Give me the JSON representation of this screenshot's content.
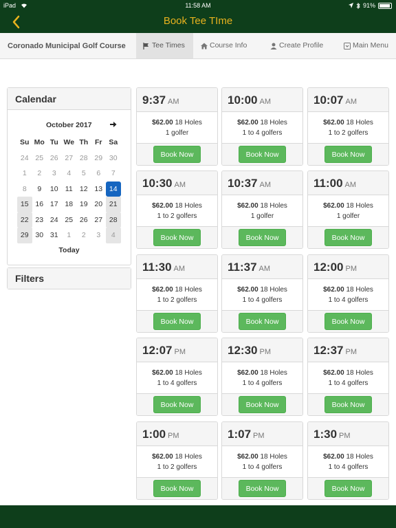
{
  "status": {
    "carrier": "iPad",
    "time": "11:58 AM",
    "battery": "91%"
  },
  "header": {
    "title": "Book Tee TIme"
  },
  "nav": {
    "brand": "Coronado Municipal Golf Course",
    "items": [
      {
        "label": "Tee Times",
        "icon": "flag-icon"
      },
      {
        "label": "Course Info",
        "icon": "home-icon"
      },
      {
        "label": "Create Profile",
        "icon": "user-icon"
      },
      {
        "label": "Main Menu",
        "icon": "menu-icon"
      }
    ]
  },
  "calendar": {
    "title": "Calendar",
    "month": "October 2017",
    "weekdays": [
      "Su",
      "Mo",
      "Tu",
      "We",
      "Th",
      "Fr",
      "Sa"
    ],
    "weeks": [
      [
        "24",
        "25",
        "26",
        "27",
        "28",
        "29",
        "30"
      ],
      [
        "1",
        "2",
        "3",
        "4",
        "5",
        "6",
        "7"
      ],
      [
        "8",
        "9",
        "10",
        "11",
        "12",
        "13",
        "14"
      ],
      [
        "15",
        "16",
        "17",
        "18",
        "19",
        "20",
        "21"
      ],
      [
        "22",
        "23",
        "24",
        "25",
        "26",
        "27",
        "28"
      ],
      [
        "29",
        "30",
        "31",
        "1",
        "2",
        "3",
        "4"
      ]
    ],
    "selected_day": "14",
    "today_label": "Today"
  },
  "filters": {
    "title": "Filters"
  },
  "tee_times": [
    {
      "time": "9:37",
      "ampm": "AM",
      "price": "$62.00",
      "holes": "18 Holes",
      "golfers": "1 golfer",
      "button": "Book Now"
    },
    {
      "time": "10:00",
      "ampm": "AM",
      "price": "$62.00",
      "holes": "18 Holes",
      "golfers": "1 to 4 golfers",
      "button": "Book Now"
    },
    {
      "time": "10:07",
      "ampm": "AM",
      "price": "$62.00",
      "holes": "18 Holes",
      "golfers": "1 to 2 golfers",
      "button": "Book Now"
    },
    {
      "time": "10:30",
      "ampm": "AM",
      "price": "$62.00",
      "holes": "18 Holes",
      "golfers": "1 to 2 golfers",
      "button": "Book Now"
    },
    {
      "time": "10:37",
      "ampm": "AM",
      "price": "$62.00",
      "holes": "18 Holes",
      "golfers": "1 golfer",
      "button": "Book Now"
    },
    {
      "time": "11:00",
      "ampm": "AM",
      "price": "$62.00",
      "holes": "18 Holes",
      "golfers": "1 golfer",
      "button": "Book Now"
    },
    {
      "time": "11:30",
      "ampm": "AM",
      "price": "$62.00",
      "holes": "18 Holes",
      "golfers": "1 to 2 golfers",
      "button": "Book Now"
    },
    {
      "time": "11:37",
      "ampm": "AM",
      "price": "$62.00",
      "holes": "18 Holes",
      "golfers": "1 to 4 golfers",
      "button": "Book Now"
    },
    {
      "time": "12:00",
      "ampm": "PM",
      "price": "$62.00",
      "holes": "18 Holes",
      "golfers": "1 to 4 golfers",
      "button": "Book Now"
    },
    {
      "time": "12:07",
      "ampm": "PM",
      "price": "$62.00",
      "holes": "18 Holes",
      "golfers": "1 to 4 golfers",
      "button": "Book Now"
    },
    {
      "time": "12:30",
      "ampm": "PM",
      "price": "$62.00",
      "holes": "18 Holes",
      "golfers": "1 to 4 golfers",
      "button": "Book Now"
    },
    {
      "time": "12:37",
      "ampm": "PM",
      "price": "$62.00",
      "holes": "18 Holes",
      "golfers": "1 to 4 golfers",
      "button": "Book Now"
    },
    {
      "time": "1:00",
      "ampm": "PM",
      "price": "$62.00",
      "holes": "18 Holes",
      "golfers": "1 to 2 golfers",
      "button": "Book Now"
    },
    {
      "time": "1:07",
      "ampm": "PM",
      "price": "$62.00",
      "holes": "18 Holes",
      "golfers": "1 to 4 golfers",
      "button": "Book Now"
    },
    {
      "time": "1:30",
      "ampm": "PM",
      "price": "$62.00",
      "holes": "18 Holes",
      "golfers": "1 to 4 golfers",
      "button": "Book Now"
    }
  ],
  "colors": {
    "bar": "#0e3e1b",
    "accent": "#e8b21e",
    "book_button": "#5cb85c",
    "selected_day": "#1565c0"
  }
}
